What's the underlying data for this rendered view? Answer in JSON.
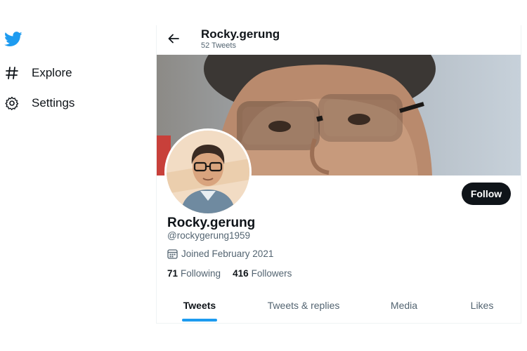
{
  "sidebar": {
    "logo": "twitter-bird-icon",
    "items": [
      {
        "icon": "hashtag-icon",
        "label": "Explore"
      },
      {
        "icon": "gear-icon",
        "label": "Settings"
      }
    ]
  },
  "header": {
    "back_icon": "arrow-left-icon",
    "name": "Rocky.gerung",
    "tweet_count": "52 Tweets"
  },
  "profile": {
    "name": "Rocky.gerung",
    "handle": "@rockygerung1959",
    "joined": "Joined February 2021",
    "following_count": "71",
    "following_label": "Following",
    "followers_count": "416",
    "followers_label": "Followers",
    "follow_label": "Follow"
  },
  "tabs": [
    "Tweets",
    "Tweets & replies",
    "Media",
    "Likes"
  ],
  "active_tab": "Tweets",
  "colors": {
    "accent": "#1d9bf0",
    "follow_button_bg": "#0f1419",
    "muted_text": "#536471"
  }
}
